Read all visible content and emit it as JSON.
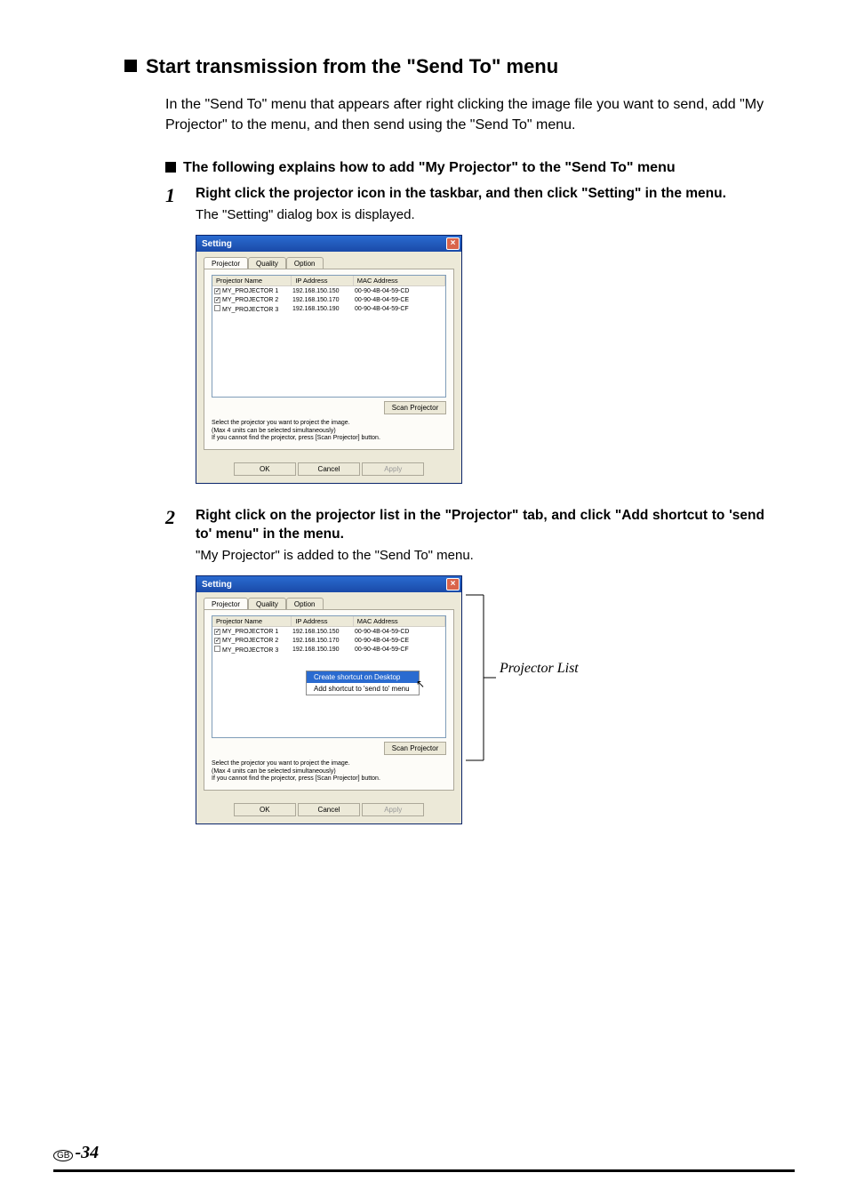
{
  "heading": {
    "title": "Start transmission from the \"Send To\" menu"
  },
  "intro": "In the \"Send To\" menu that appears after right clicking the image file you want to send, add \"My Projector\" to the menu, and then send using the \"Send To\" menu.",
  "subheading": "The following explains how to add \"My Projector\" to the \"Send To\" menu",
  "steps": [
    {
      "num": "1",
      "title": "Right click the projector icon in the taskbar, and then click \"Setting\" in the menu.",
      "sub": "The \"Setting\" dialog box is displayed."
    },
    {
      "num": "2",
      "title": "Right click on the projector list in the \"Projector\" tab, and click \"Add shortcut to 'send to' menu\" in the menu.",
      "sub": "\"My Projector\" is added to the \"Send To\" menu."
    }
  ],
  "dialog": {
    "title": "Setting",
    "tabs": {
      "projector": "Projector",
      "quality": "Quality",
      "option": "Option"
    },
    "columns": {
      "name": "Projector Name",
      "ip": "IP Address",
      "mac": "MAC Address"
    },
    "rows": [
      {
        "checked": true,
        "name": "MY_PROJECTOR 1",
        "ip": "192.168.150.150",
        "mac": "00-90-4B-04-59-CD"
      },
      {
        "checked": true,
        "name": "MY_PROJECTOR 2",
        "ip": "192.168.150.170",
        "mac": "00-90-4B-04-59-CE"
      },
      {
        "checked": false,
        "name": "MY_PROJECTOR 3",
        "ip": "192.168.150.190",
        "mac": "00-90-4B-04-59-CF"
      }
    ],
    "scan_btn": "Scan Projector",
    "help1": "Select the projector you want to project the image.",
    "help2": "(Max 4 units can be selected simultaneously)",
    "help3": "If you cannot find the projector, press [Scan Projector] button.",
    "ok": "OK",
    "cancel": "Cancel",
    "apply": "Apply"
  },
  "context_menu": {
    "item1": "Create shortcut on Desktop",
    "item2": "Add shortcut to 'send to' menu"
  },
  "callout": "Projector List",
  "footer": {
    "gb": "GB",
    "dash": "-",
    "page": "34"
  }
}
